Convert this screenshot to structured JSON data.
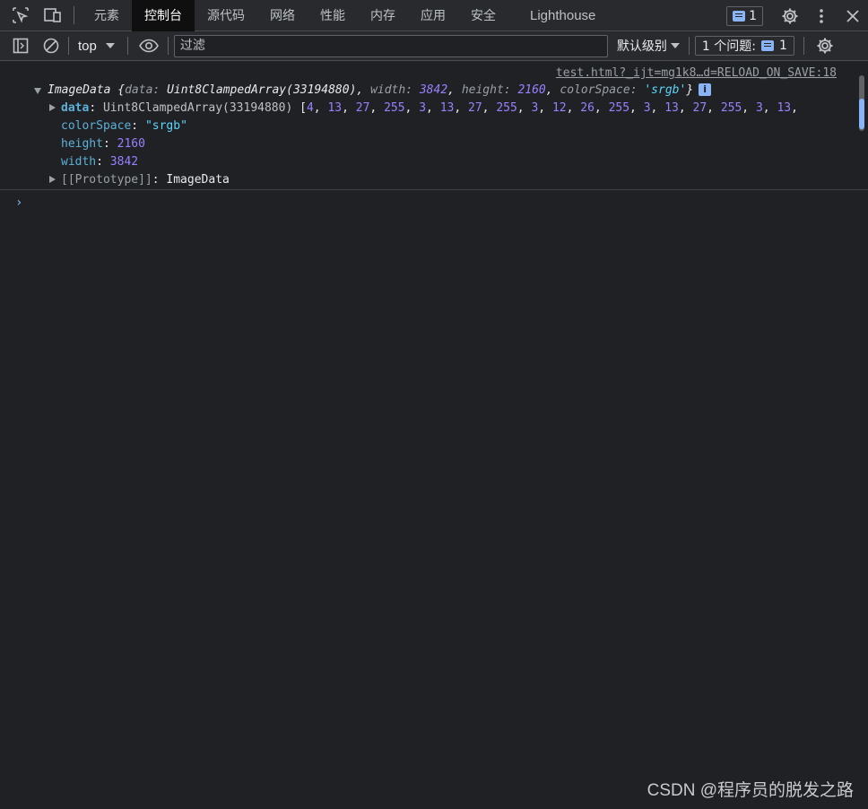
{
  "tabs": [
    {
      "label": "元素"
    },
    {
      "label": "控制台",
      "active": true
    },
    {
      "label": "源代码"
    },
    {
      "label": "网络"
    },
    {
      "label": "性能"
    },
    {
      "label": "内存"
    },
    {
      "label": "应用"
    },
    {
      "label": "安全"
    },
    {
      "label": "Lighthouse"
    }
  ],
  "header_right": {
    "message_count": "1",
    "icons": [
      "settings-icon",
      "more-vertical-icon",
      "close-icon"
    ]
  },
  "toolbar": {
    "context": "top",
    "filter_placeholder": "过滤",
    "levels_label": "默认级别",
    "issues_label": "1 个问题:",
    "issues_count": "1"
  },
  "log": {
    "source": "test.html?_ijt=mg1k8…d=RELOAD_ON_SAVE:18",
    "summary": {
      "class": "ImageData",
      "data_key": "data",
      "data_val": "Uint8ClampedArray(33194880)",
      "width_key": "width",
      "width_val": "3842",
      "height_key": "height",
      "height_val": "2160",
      "cs_key": "colorSpace",
      "cs_val": "'srgb'"
    },
    "props": {
      "data_key": "data",
      "data_type": "Uint8ClampedArray(33194880)",
      "data_values": [
        4,
        13,
        27,
        255,
        3,
        13,
        27,
        255,
        3,
        12,
        26,
        255,
        3,
        13,
        27,
        255,
        3,
        13
      ],
      "colorspace_key": "colorSpace",
      "colorspace_val": "\"srgb\"",
      "height_key": "height",
      "height_val": "2160",
      "width_key": "width",
      "width_val": "3842",
      "proto_key": "[[Prototype]]",
      "proto_val": "ImageData"
    }
  },
  "watermark": "CSDN @程序员的脱发之路",
  "colors": {
    "background": "#202124",
    "toolbar": "#292a2d",
    "number": "#9980ff",
    "string": "#5cd5fb",
    "key": "#5db0d7",
    "accent": "#8ab4f8"
  }
}
